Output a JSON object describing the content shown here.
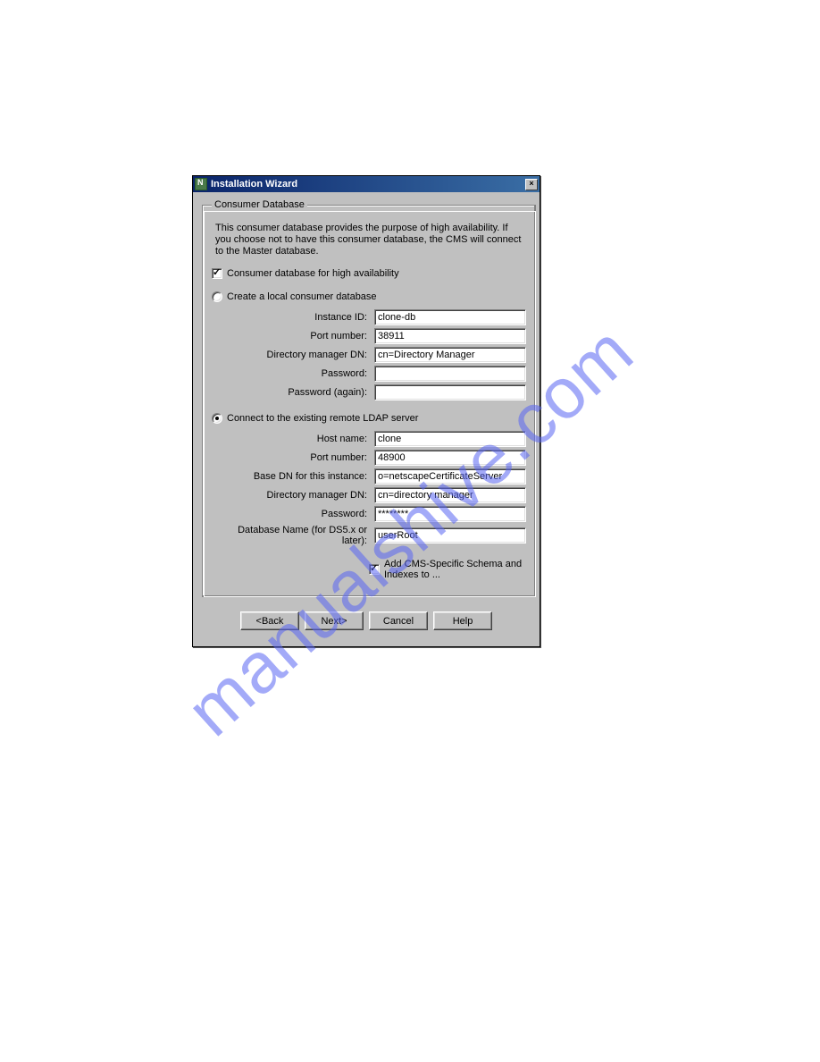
{
  "watermark": "manualshive.com",
  "dialog": {
    "title": "Installation Wizard",
    "close_glyph": "×",
    "group": {
      "legend": "Consumer Database",
      "description": "This consumer database provides the purpose of high availability. If you choose not to have this consumer database, the CMS will connect to the Master database.",
      "checkbox_ha": {
        "label": "Consumer database for high availability",
        "checked": true
      },
      "radio_local": {
        "label": "Create a local consumer database",
        "checked": false
      },
      "local_fields": {
        "instance_id": {
          "label": "Instance ID:",
          "value": "clone-db"
        },
        "port": {
          "label": "Port number:",
          "value": "38911"
        },
        "dm_dn": {
          "label": "Directory manager DN:",
          "value": "cn=Directory Manager"
        },
        "password": {
          "label": "Password:",
          "value": ""
        },
        "password_again": {
          "label": "Password (again):",
          "value": ""
        }
      },
      "radio_remote": {
        "label": "Connect to the existing remote LDAP server",
        "checked": true
      },
      "remote_fields": {
        "host": {
          "label": "Host name:",
          "value": "clone"
        },
        "port": {
          "label": "Port number:",
          "value": "48900"
        },
        "base_dn": {
          "label": "Base DN for this instance:",
          "value": "o=netscapeCertificateServer"
        },
        "dm_dn": {
          "label": "Directory manager DN:",
          "value": "cn=directory manager"
        },
        "password": {
          "label": "Password:",
          "value": "********"
        },
        "db_name": {
          "label": "Database Name (for DS5.x or later):",
          "value": "userRoot"
        }
      },
      "schema_checkbox": {
        "label": "Add CMS-Specific Schema and Indexes to ...",
        "checked": true
      }
    },
    "buttons": {
      "back": "<Back",
      "next": "Next>",
      "cancel": "Cancel",
      "help": "Help"
    }
  }
}
